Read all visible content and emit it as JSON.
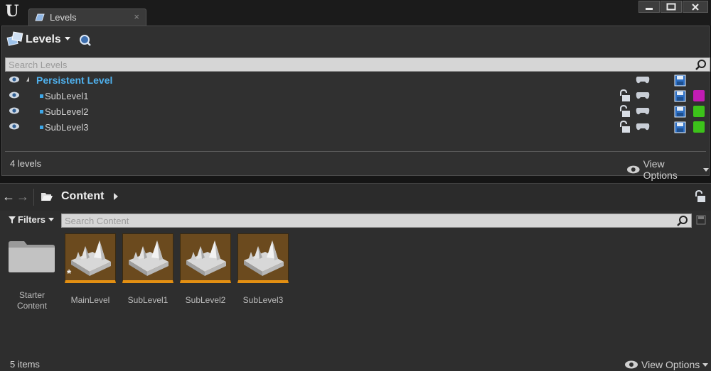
{
  "window": {
    "tab_label": "Levels",
    "tab_close": "×"
  },
  "levels_panel": {
    "title": "Levels",
    "search_placeholder": "Search Levels",
    "persistent_level": "Persistent Level",
    "sublevels": [
      {
        "name": "SubLevel1",
        "color": "#c21cb4"
      },
      {
        "name": "SubLevel2",
        "color": "#3cc21a"
      },
      {
        "name": "SubLevel3",
        "color": "#3cc21a"
      }
    ],
    "count": "4 levels",
    "view_options": "View Options"
  },
  "content_browser": {
    "path": "Content",
    "filters": "Filters",
    "search_placeholder": "Search Content",
    "folder": {
      "label": "Starter\nContent"
    },
    "assets": [
      {
        "label": "MainLevel",
        "modified": true
      },
      {
        "label": "SubLevel1",
        "modified": false
      },
      {
        "label": "SubLevel2",
        "modified": false
      },
      {
        "label": "SubLevel3",
        "modified": false
      }
    ],
    "count": "5 items",
    "view_options": "View Options"
  },
  "icons": [
    "ue-logo-icon",
    "levels-icon",
    "search-icon",
    "eye-icon",
    "lock-icon",
    "gamepad-icon",
    "save-icon",
    "folder-icon",
    "filter-icon"
  ],
  "colors": {
    "accent_blue": "#4fb0ec",
    "thumb_border": "#e38f12"
  }
}
